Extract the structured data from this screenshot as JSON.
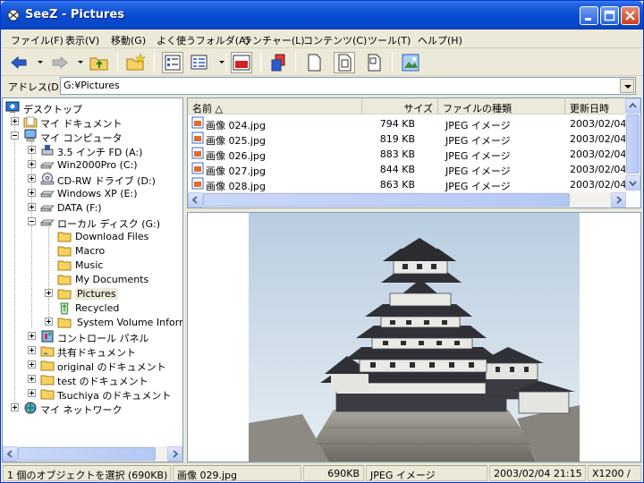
{
  "window": {
    "title": "SeeZ - Pictures"
  },
  "menu": [
    {
      "label": "ファイル(F)"
    },
    {
      "label": "表示(V)"
    },
    {
      "label": "移動(G)"
    },
    {
      "label": "よく使うフォルダ(A)"
    },
    {
      "label": "ランチャー(L)"
    },
    {
      "label": "コンテンツ(C)"
    },
    {
      "label": "ツール(T)"
    },
    {
      "label": "ヘルプ(H)"
    }
  ],
  "address": {
    "label": "アドレス(D)",
    "value": "G:¥Pictures"
  },
  "tree": {
    "items": [
      {
        "label": "デスクトップ",
        "icon": "desktop-icon"
      },
      {
        "label": "マイ ドキュメント",
        "icon": "my-documents-icon"
      },
      {
        "label": "マイ コンピュータ",
        "icon": "my-computer-icon"
      },
      {
        "label": "3.5 インチ FD (A:)",
        "icon": "floppy-icon"
      },
      {
        "label": "Win2000Pro (C:)",
        "icon": "drive-icon"
      },
      {
        "label": "CD-RW ドライブ (D:)",
        "icon": "cd-drive-icon"
      },
      {
        "label": "Windows XP (E:)",
        "icon": "drive-icon"
      },
      {
        "label": "DATA (F:)",
        "icon": "drive-icon"
      },
      {
        "label": "ローカル ディスク (G:)",
        "icon": "drive-icon"
      },
      {
        "label": "Download Files",
        "icon": "folder-icon"
      },
      {
        "label": "Macro",
        "icon": "folder-icon"
      },
      {
        "label": "Music",
        "icon": "folder-icon"
      },
      {
        "label": "My Documents",
        "icon": "folder-icon"
      },
      {
        "label": "Pictures",
        "icon": "folder-icon"
      },
      {
        "label": "Recycled",
        "icon": "recycle-icon"
      },
      {
        "label": "System Volume Informa",
        "icon": "folder-icon"
      },
      {
        "label": "コントロール パネル",
        "icon": "control-panel-icon"
      },
      {
        "label": "共有ドキュメント",
        "icon": "folder-icon"
      },
      {
        "label": "original のドキュメント",
        "icon": "folder-icon"
      },
      {
        "label": "test のドキュメント",
        "icon": "folder-icon"
      },
      {
        "label": "Tsuchiya のドキュメント",
        "icon": "folder-icon"
      },
      {
        "label": "マイ ネットワーク",
        "icon": "network-icon"
      }
    ]
  },
  "list": {
    "columns": [
      {
        "label": "名前 △"
      },
      {
        "label": "サイズ"
      },
      {
        "label": "ファイルの種類"
      },
      {
        "label": "更新日時"
      }
    ],
    "rows": [
      {
        "name": "画像 024.jpg",
        "size": "794 KB",
        "type": "JPEG イメージ",
        "date": "2003/02/04"
      },
      {
        "name": "画像 025.jpg",
        "size": "819 KB",
        "type": "JPEG イメージ",
        "date": "2003/02/04"
      },
      {
        "name": "画像 026.jpg",
        "size": "883 KB",
        "type": "JPEG イメージ",
        "date": "2003/02/04"
      },
      {
        "name": "画像 027.jpg",
        "size": "844 KB",
        "type": "JPEG イメージ",
        "date": "2003/02/04"
      },
      {
        "name": "画像 028.jpg",
        "size": "863 KB",
        "type": "JPEG イメージ",
        "date": "2003/02/04"
      }
    ]
  },
  "status": {
    "selection": "1 個のオブジェクトを選択 (690KB)",
    "filename": "画像 029.jpg",
    "size": "690KB",
    "type": "JPEG イメージ",
    "date": "2003/02/04 21:15",
    "dims": "X1200 /"
  }
}
